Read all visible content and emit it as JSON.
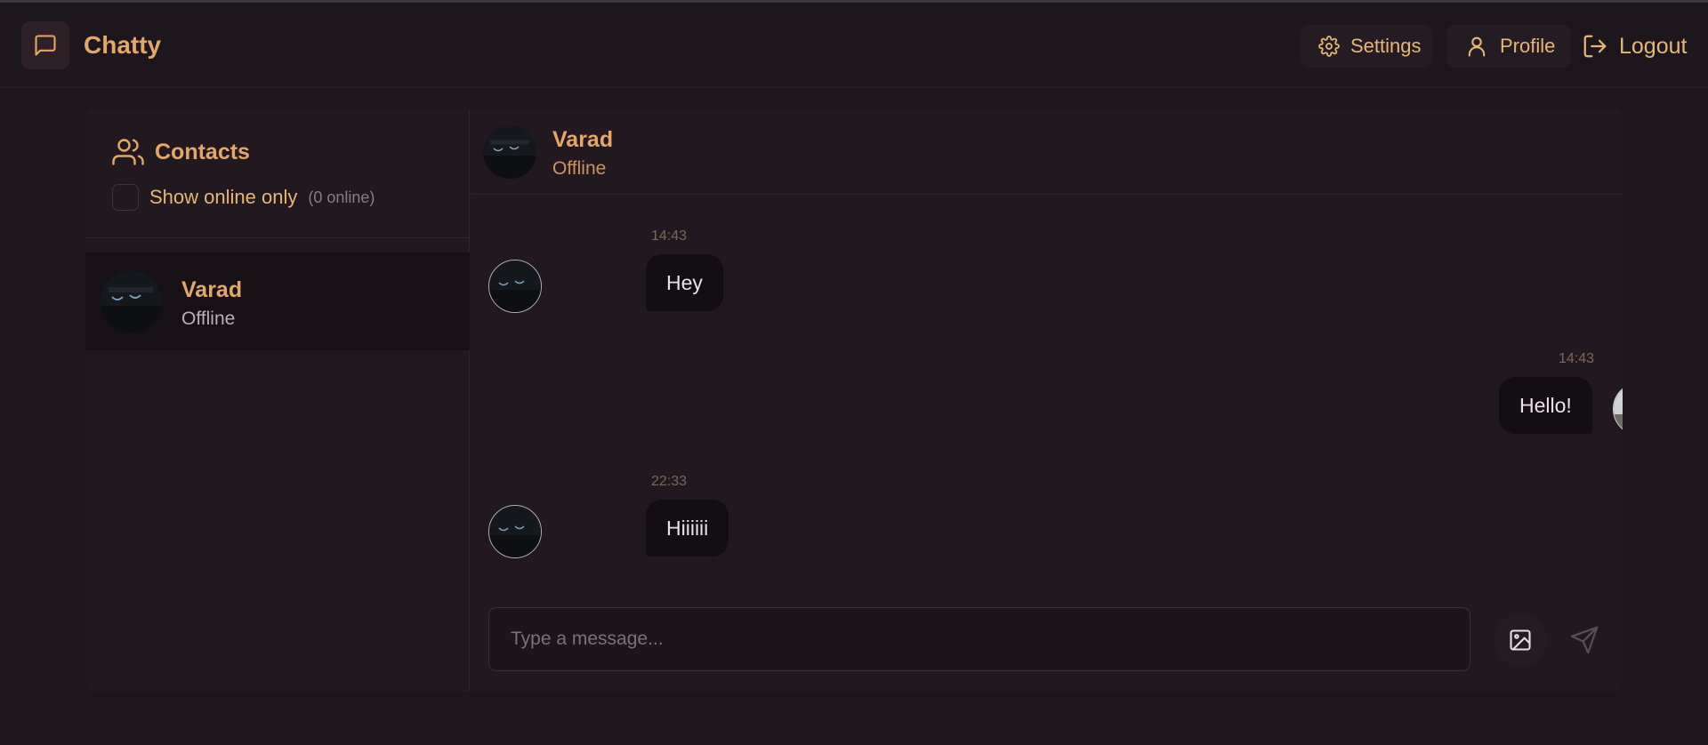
{
  "app": {
    "name": "Chatty"
  },
  "nav": {
    "settings_label": "Settings",
    "profile_label": "Profile",
    "logout_label": "Logout"
  },
  "sidebar": {
    "title": "Contacts",
    "filter_label": "Show online only",
    "online_count": "(0 online)",
    "contacts": [
      {
        "name": "Varad",
        "status": "Offline",
        "selected": true
      }
    ]
  },
  "chat": {
    "contact_name": "Varad",
    "contact_status": "Offline",
    "messages": [
      {
        "time": "14:43",
        "text": "Hey",
        "side": "received"
      },
      {
        "time": "14:43",
        "text": "Hello!",
        "side": "sent"
      },
      {
        "time": "22:33",
        "text": "Hiiiiii",
        "side": "received"
      }
    ],
    "input_placeholder": "Type a message..."
  },
  "colors": {
    "background": "#1e161d",
    "accent": "#e3a868",
    "bubble": "#130e12"
  },
  "icons": [
    "chat-bubble-icon",
    "gear-icon",
    "user-icon",
    "logout-icon",
    "users-icon",
    "close-icon",
    "image-icon",
    "send-icon"
  ]
}
